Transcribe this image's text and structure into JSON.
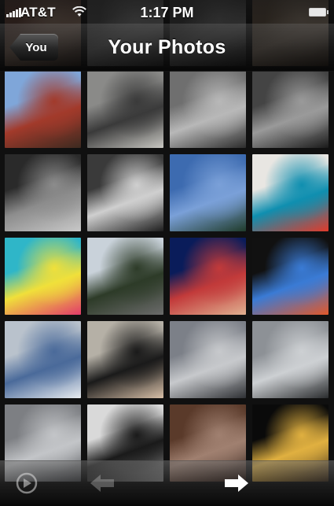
{
  "status_bar": {
    "carrier": "AT&T",
    "time": "1:17 PM",
    "signal_bars": 5,
    "battery_level": 1.0
  },
  "nav_bar": {
    "back_label": "You",
    "title": "Your Photos"
  },
  "toolbar": {
    "left_icon": "play-slideshow-icon",
    "prev_icon": "arrow-left-icon",
    "next_icon": "arrow-right-icon",
    "prev_enabled": false,
    "next_enabled": true
  },
  "colors": {
    "nav_gradient_top": "#464646",
    "nav_gradient_bottom": "#000000",
    "text": "#ffffff"
  },
  "photos": [
    {
      "subject": "roller-coaster-photo",
      "colors": [
        "#7fa6d9",
        "#a23a2b",
        "#3c2a20"
      ]
    },
    {
      "subject": "gorilla-photo",
      "colors": [
        "#8a8a88",
        "#3a3a3a",
        "#c8c7c2"
      ]
    },
    {
      "subject": "keyboard-synth-photo",
      "colors": [
        "#6f6f6f",
        "#b8b8b8",
        "#2c2c2c"
      ]
    },
    {
      "subject": "studio-equipment-photo",
      "colors": [
        "#444444",
        "#9a9a9a",
        "#1a1a1a"
      ]
    },
    {
      "subject": "office-interior-photo",
      "colors": [
        "#2a2a2a",
        "#8c8c8c",
        "#c8c8c8"
      ]
    },
    {
      "subject": "office-lights-photo",
      "colors": [
        "#3a3a3a",
        "#cfcfcf",
        "#1e1e1e"
      ]
    },
    {
      "subject": "sky-rainbow-photo",
      "colors": [
        "#3d6bb0",
        "#7aa0d8",
        "#1f3b2a"
      ]
    },
    {
      "subject": "gift-box-photo",
      "colors": [
        "#e8e6e2",
        "#0f8fb0",
        "#e23a2a"
      ]
    },
    {
      "subject": "letter-blocks-photo",
      "colors": [
        "#2fb6c8",
        "#f0e03a",
        "#e23a6a"
      ]
    },
    {
      "subject": "trees-sky-photo",
      "colors": [
        "#c9d2da",
        "#2d3b28",
        "#6b6b6b"
      ]
    },
    {
      "subject": "news-anchor-photo",
      "colors": [
        "#0a1c5a",
        "#c23a3a",
        "#e0b090"
      ]
    },
    {
      "subject": "iphone-homescreen-photo",
      "colors": [
        "#111111",
        "#3a7bd5",
        "#e2582a"
      ]
    },
    {
      "subject": "iphone-alert-dialog-photo",
      "colors": [
        "#b9c2cc",
        "#4a6a9a",
        "#e8ecf0"
      ]
    },
    {
      "subject": "hand-card-reader-photo",
      "colors": [
        "#b5b0a6",
        "#1a1a1a",
        "#d8c0a8"
      ]
    },
    {
      "subject": "cloudy-sky-photo",
      "colors": [
        "#7c8088",
        "#c7c9cc",
        "#2e3034"
      ]
    },
    {
      "subject": "cloudy-sky-photo-2",
      "colors": [
        "#8d9196",
        "#cdd0d3",
        "#2a2c2e"
      ]
    },
    {
      "subject": "storm-clouds-photo",
      "colors": [
        "#7d7f83",
        "#c3c5c8",
        "#4a4c50"
      ]
    },
    {
      "subject": "iphone-dock-photo",
      "colors": [
        "#d9d9d9",
        "#1a1a1a",
        "#8a8a8a"
      ]
    },
    {
      "subject": "crowd-event-photo",
      "colors": [
        "#5a3a2a",
        "#a08070",
        "#2a1a14"
      ]
    },
    {
      "subject": "string-lights-photo",
      "colors": [
        "#0a0a0a",
        "#e0b040",
        "#3a2a1a"
      ]
    }
  ],
  "peek_photos": [
    {
      "subject": "peek-photo-1",
      "colors": [
        "#5a3a30",
        "#8a7060",
        "#2a201a"
      ]
    },
    {
      "subject": "peek-photo-2",
      "colors": [
        "#4a4a4a",
        "#7a7a7a",
        "#2a2a2a"
      ]
    },
    {
      "subject": "peek-photo-3",
      "colors": [
        "#3a3a3a",
        "#6a6a6a",
        "#1a1a1a"
      ]
    },
    {
      "subject": "peek-photo-4",
      "colors": [
        "#5a4a3a",
        "#8a7a6a",
        "#2a2018"
      ]
    }
  ]
}
